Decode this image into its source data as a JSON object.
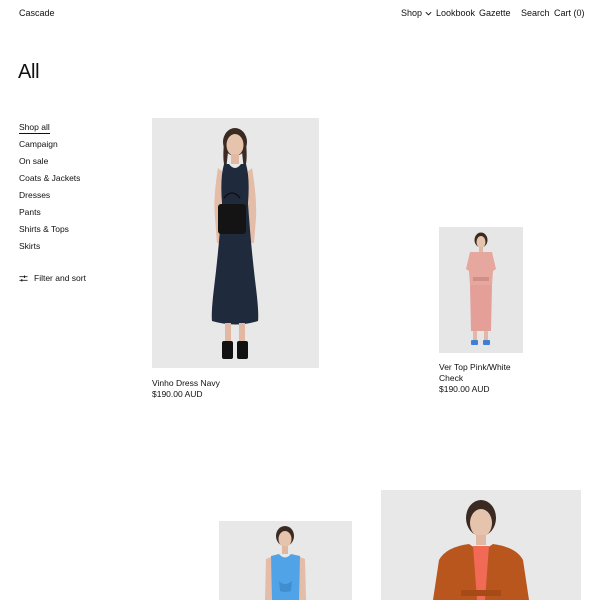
{
  "header": {
    "brand": "Cascade",
    "nav": {
      "shop": "Shop",
      "lookbook": "Lookbook",
      "gazette": "Gazette",
      "search": "Search",
      "cart": "Cart (0)"
    }
  },
  "page": {
    "title": "All"
  },
  "sidebar": {
    "categories": [
      {
        "label": "Shop all",
        "active": true
      },
      {
        "label": "Campaign"
      },
      {
        "label": "On sale"
      },
      {
        "label": "Coats & Jackets"
      },
      {
        "label": "Dresses"
      },
      {
        "label": "Pants"
      },
      {
        "label": "Shirts & Tops"
      },
      {
        "label": "Skirts"
      }
    ],
    "filter_label": "Filter and sort"
  },
  "products": [
    {
      "name": "Vinho Dress Navy",
      "price": "$190.00 AUD",
      "garment_color": "#1f2a3c"
    },
    {
      "name": "Ver Top Pink/White Check",
      "price": "$190.00 AUD",
      "garment_color": "#e6a79f"
    },
    {
      "name": "",
      "price": "",
      "garment_color": "#4fa3e6"
    },
    {
      "name": "",
      "price": "",
      "garment_color": "#b8561e"
    }
  ],
  "icons": {
    "shop_dropdown": "chevron-down-icon",
    "filter": "sliders-icon",
    "handbag": "handbag-icon"
  }
}
